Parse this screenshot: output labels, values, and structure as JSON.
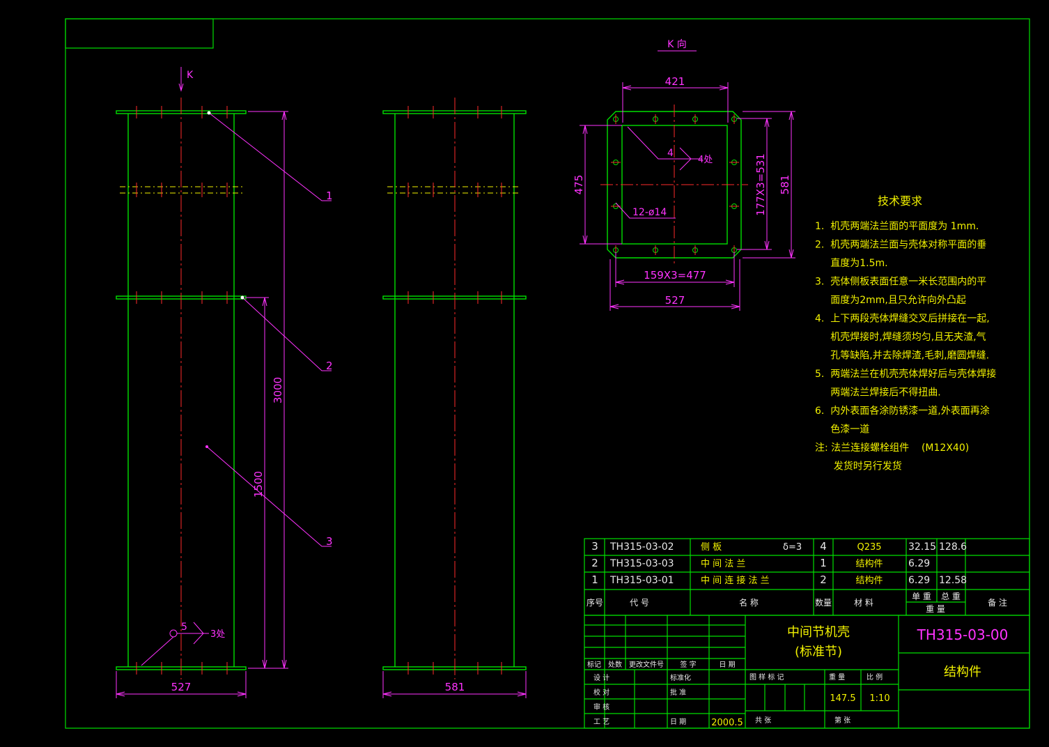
{
  "colors": {
    "background": "#000000",
    "frame": "#00e000",
    "dimension": "#ff33ff",
    "centerline": "#ff2a2a",
    "text_table": "#f2f200",
    "text_notes": "#f2f200",
    "drawing_number": "#ff33ff"
  },
  "view_k": {
    "arrow_label": "K",
    "view_title": "K  向",
    "dims": {
      "top": "421",
      "left": "475",
      "right_inner": "177X3=531",
      "right_outer": "581",
      "bottom_inner": "159X3=477",
      "bottom_outer": "527"
    },
    "weld_size": "4",
    "weld_count": "4处",
    "hole_spec": "12-ø14"
  },
  "front_view": {
    "height_total": "3000",
    "height_half": "1500",
    "width": "527",
    "balloons": [
      "1",
      "2",
      "3"
    ],
    "weld_size": "5",
    "weld_count": "3处"
  },
  "side_view": {
    "width": "581"
  },
  "tech_notes": {
    "title": "技术要求",
    "lines": [
      "1.  机壳两端法兰面的平面度为 1mm.",
      "2.  机壳两端法兰面与壳体对称平面的垂",
      "     直度为1.5m.",
      "3.  壳体侧板表面任意一米长范围内的平",
      "     面度为2mm,且只允许向外凸起",
      "4.  上下两段壳体焊缝交叉后拼接在一起,",
      "     机壳焊接时,焊缝须均匀,且无夹渣,气",
      "     孔等缺陷,并去除焊渣,毛刺,磨圆焊缝.",
      "5.  两端法兰在机壳壳体焊好后与壳体焊接",
      "     两端法兰焊接后不得扭曲.",
      "6.  内外表面各涂防锈漆一道,外表面再涂",
      "     色漆一道",
      "注: 法兰连接螺栓组件    (M12X40)",
      "      发货时另行发货"
    ]
  },
  "parts_list": {
    "rows": [
      {
        "no": "3",
        "code": "TH315-03-02",
        "name": "侧  板",
        "extra": "δ=3",
        "qty": "4",
        "material": "Q235",
        "unit_wt": "32.15",
        "total_wt": "128.6",
        "remark": ""
      },
      {
        "no": "2",
        "code": "TH315-03-03",
        "name": "中 间 法 兰",
        "extra": "",
        "qty": "1",
        "material": "结构件",
        "unit_wt": "6.29",
        "total_wt": "",
        "remark": ""
      },
      {
        "no": "1",
        "code": "TH315-03-01",
        "name": "中 间 连 接 法 兰",
        "extra": "",
        "qty": "2",
        "material": "结构件",
        "unit_wt": "6.29",
        "total_wt": "12.58",
        "remark": ""
      }
    ],
    "header": {
      "no": "序号",
      "code": "代     号",
      "name": "名          称",
      "qty": "数量",
      "material": "材    料",
      "unit_wt": "单 重",
      "total_wt": "总 重",
      "weight": "重   量",
      "remark": "备  注"
    }
  },
  "title_block": {
    "name_line1": "中间节机壳",
    "name_line2": "(标准节)",
    "drawing_no": "TH315-03-00",
    "category": "结构件",
    "rev_headers": [
      "标记",
      "处数",
      "更改文件号",
      "签  字",
      "日  期"
    ],
    "labels": {
      "design": "设  计",
      "check": "校  对",
      "review": "审  核",
      "process": "工  艺",
      "standard": "标准化",
      "approve": "批  准",
      "date": "日  期",
      "stage_mark": "图  样  标  记",
      "weight": "重  量",
      "scale": "比  例",
      "total_sheets": "共          张",
      "sheet_no": "第          张"
    },
    "date_value": "2000.5",
    "weight_value": "147.5",
    "scale_value": "1:10"
  }
}
